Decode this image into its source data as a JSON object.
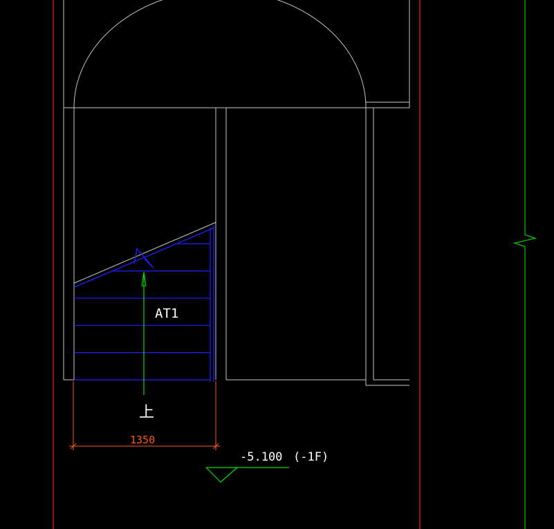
{
  "canvas": {
    "background": "#000000"
  },
  "colors": {
    "wall": "#c8c8c8",
    "grid_axis": "#ff2020",
    "break_line": "#00d000",
    "stair": "#2020ff",
    "arrow": "#00e000",
    "dimension": "#ff5a14",
    "text": "#ffffff",
    "level_marker": "#00e000"
  },
  "stair": {
    "label": "AT1",
    "direction_label": "上",
    "tread_count": 6
  },
  "dimension": {
    "value": "1350"
  },
  "level": {
    "elevation": "-5.100",
    "floor": "(-1F)"
  }
}
